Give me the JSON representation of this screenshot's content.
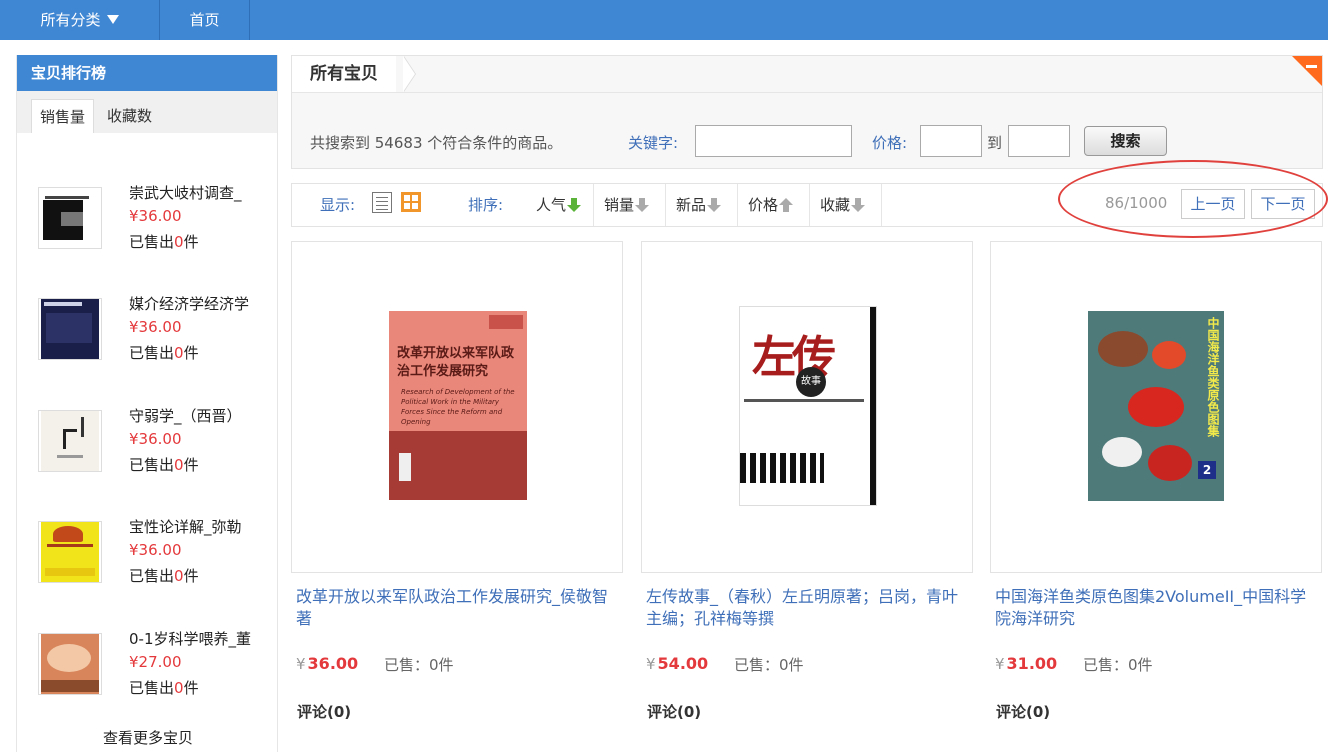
{
  "topnav": {
    "category_label": "所有分类",
    "home_label": "首页"
  },
  "sidebar": {
    "title": "宝贝排行榜",
    "tabs": [
      "销售量",
      "收藏数"
    ],
    "items": [
      {
        "title": "崇武大岐村调查_",
        "price": "¥36.00",
        "sold_prefix": "已售出",
        "sold_count": "0",
        "sold_suffix": "件"
      },
      {
        "title": "媒介经济学经济学",
        "price": "¥36.00",
        "sold_prefix": "已售出",
        "sold_count": "0",
        "sold_suffix": "件"
      },
      {
        "title": "守弱学_（西晋）",
        "price": "¥36.00",
        "sold_prefix": "已售出",
        "sold_count": "0",
        "sold_suffix": "件"
      },
      {
        "title": "宝性论详解_弥勒",
        "price": "¥36.00",
        "sold_prefix": "已售出",
        "sold_count": "0",
        "sold_suffix": "件"
      },
      {
        "title": "0-1岁科学喂养_董",
        "price": "¥27.00",
        "sold_prefix": "已售出",
        "sold_count": "0",
        "sold_suffix": "件"
      }
    ],
    "more_label": "查看更多宝贝"
  },
  "crumb": {
    "title": "所有宝贝"
  },
  "search": {
    "count_text": "共搜索到 54683 个符合条件的商品。",
    "keyword_label": "关键字:",
    "keyword_value": "",
    "price_label": "价格:",
    "price_from": "",
    "to_label": "到",
    "price_to": "",
    "button_label": "搜索"
  },
  "toolbar": {
    "show_label": "显示:",
    "sort_label": "排序:",
    "sort_options": [
      "人气",
      "销量",
      "新品",
      "价格",
      "收藏"
    ],
    "page_info": "86/1000",
    "prev_label": "上一页",
    "next_label": "下一页"
  },
  "products": [
    {
      "title": "改革开放以来军队政治工作发展研究_侯敬智著",
      "yen": "¥",
      "price": "36.00",
      "sold": "已售：0件",
      "review_label": "评论",
      "review_count": "(0)",
      "cover_title": "改革开放以来军队政治工作发展研究",
      "cover_en": "Research of Development of the Political Work in the Military Forces Since the Reform and Opening"
    },
    {
      "title": "左传故事_（春秋）左丘明原著；吕岗，青叶主编；孔祥梅等撰",
      "yen": "¥",
      "price": "54.00",
      "sold": "已售：0件",
      "review_label": "评论",
      "review_count": "(0)",
      "cover_title": "左传",
      "cover_sub": "故事"
    },
    {
      "title": "中国海洋鱼类原色图集2VolumeII_中国科学院海洋研究",
      "yen": "¥",
      "price": "31.00",
      "sold": "已售：0件",
      "review_label": "评论",
      "review_count": "(0)",
      "cover_title": "中国海洋鱼类原色图集",
      "cover_num": "2"
    }
  ],
  "colors": {
    "brand_blue": "#3f86d3",
    "price_red": "#e4393c",
    "link_blue": "#3f6fb8",
    "grid_orange": "#f0962a"
  }
}
